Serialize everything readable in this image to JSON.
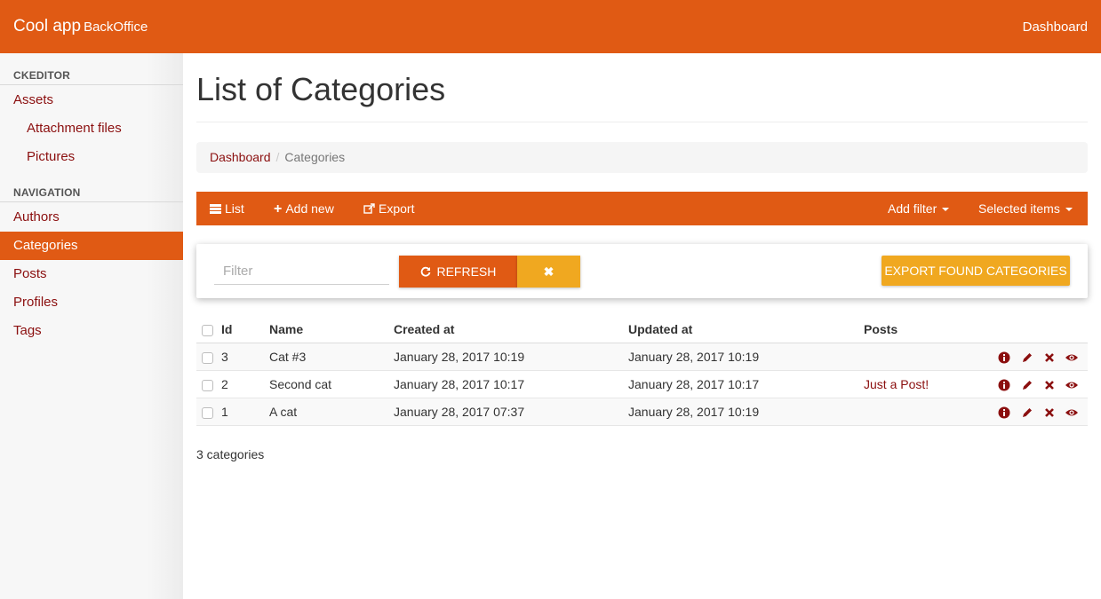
{
  "app": {
    "brand": "Cool app",
    "brand_sub": "BackOffice",
    "top_link": "Dashboard",
    "accent_color": "#e05a14",
    "secondary_color": "#f0a820",
    "link_color": "#8b0f0f"
  },
  "sidebar": {
    "sections": [
      {
        "header": "CKEDITOR",
        "items": [
          {
            "label": "Assets",
            "sub": false,
            "active": false
          },
          {
            "label": "Attachment files",
            "sub": true,
            "active": false
          },
          {
            "label": "Pictures",
            "sub": true,
            "active": false
          }
        ]
      },
      {
        "header": "NAVIGATION",
        "items": [
          {
            "label": "Authors",
            "active": false
          },
          {
            "label": "Categories",
            "active": true
          },
          {
            "label": "Posts",
            "active": false
          },
          {
            "label": "Profiles",
            "active": false
          },
          {
            "label": "Tags",
            "active": false
          }
        ]
      }
    ]
  },
  "page": {
    "title": "List of Categories",
    "breadcrumb": [
      "Dashboard",
      "Categories"
    ]
  },
  "actionbar": {
    "list": "List",
    "add_new": "Add new",
    "export": "Export",
    "add_filter": "Add filter",
    "selected_items": "Selected items",
    "icons": [
      "list-icon",
      "plus-icon",
      "share-square-icon",
      "caret-down-icon"
    ]
  },
  "filter": {
    "placeholder": "Filter",
    "value": "",
    "refresh_label": "REFRESH",
    "clear_label": "✖",
    "export_label": "EXPORT FOUND CATEGORIES",
    "icons": [
      "refresh-icon",
      "close-icon"
    ]
  },
  "table": {
    "columns": [
      "Id",
      "Name",
      "Created at",
      "Updated at",
      "Posts"
    ],
    "rows": [
      {
        "id": "3",
        "name": "Cat #3",
        "created": "January 28, 2017 10:19",
        "updated": "January 28, 2017 10:19",
        "posts": ""
      },
      {
        "id": "2",
        "name": "Second cat",
        "created": "January 28, 2017 10:17",
        "updated": "January 28, 2017 10:17",
        "posts": "Just a Post!"
      },
      {
        "id": "1",
        "name": "A cat",
        "created": "January 28, 2017 07:37",
        "updated": "January 28, 2017 10:19",
        "posts": ""
      }
    ],
    "row_action_icons": [
      "info-icon",
      "edit-pencil-icon",
      "delete-x-icon",
      "view-eye-icon"
    ]
  },
  "footer": {
    "count": "3 categories"
  }
}
